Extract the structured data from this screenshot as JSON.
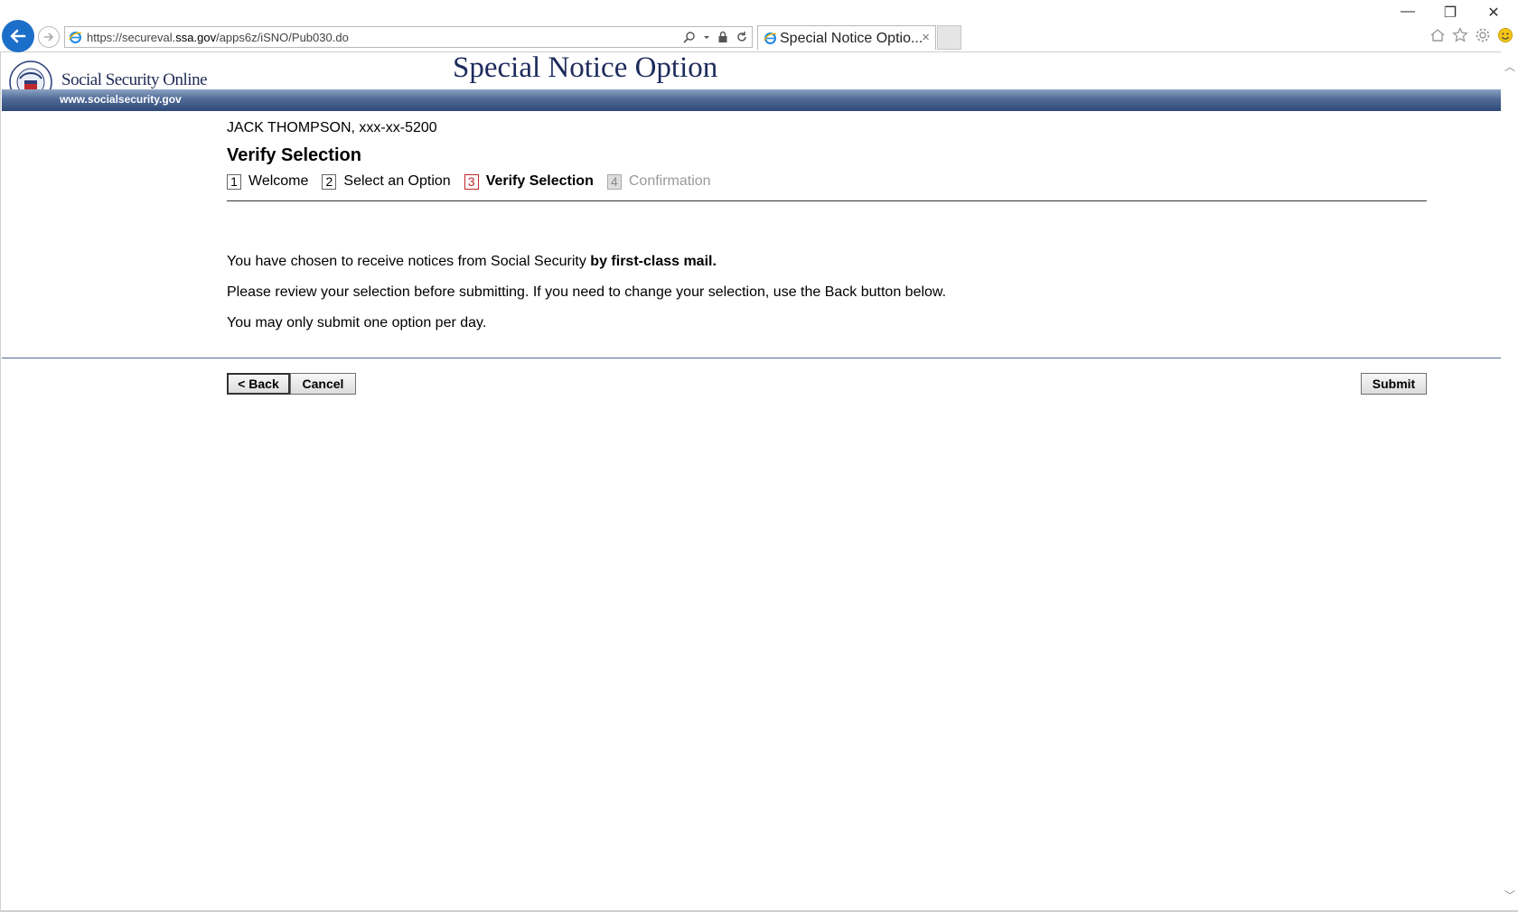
{
  "browser": {
    "url_prefix": "https://secureval.",
    "url_domain": "ssa.gov",
    "url_path": "/apps6z/iSNO/Pub030.do",
    "tab_title": "Special Notice Optio...",
    "tab_close": "×",
    "back_icon": "arrow-left-icon",
    "forward_icon": "arrow-right-icon",
    "window_controls": {
      "minimize": "—",
      "restore": "❐",
      "close": "✕"
    }
  },
  "site": {
    "name": "Social Security Online",
    "banner_url": "www.socialsecurity.gov",
    "seal_text": "USA",
    "page_title": "Special Notice Option"
  },
  "content": {
    "user_name": "JACK THOMPSON,",
    "user_ssn": "xxx-xx-5200",
    "heading": "Verify Selection",
    "steps": [
      {
        "num": "1",
        "label": "Welcome",
        "state": "done"
      },
      {
        "num": "2",
        "label": "Select an Option",
        "state": "done"
      },
      {
        "num": "3",
        "label": "Verify Selection",
        "state": "active"
      },
      {
        "num": "4",
        "label": "Confirmation",
        "state": "disabled"
      }
    ],
    "para1_text": "You have chosen to receive notices from Social Security ",
    "para1_bold": "by first-class mail.",
    "para2": "Please review your selection before submitting. If you need to change your selection, use the Back button below.",
    "para3": "You may only submit one option per day.",
    "back_label": "< Back",
    "cancel_label": "Cancel",
    "submit_label": "Submit"
  }
}
